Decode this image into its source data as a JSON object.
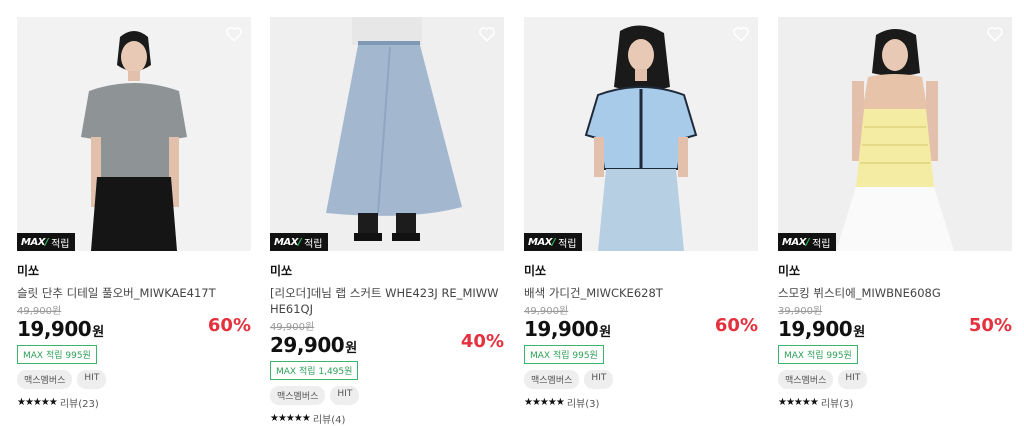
{
  "products": [
    {
      "badge": "적립",
      "brand": "미쏘",
      "name": "슬릿 단추 디테일 풀오버_MIWKAE417T",
      "original_price": "49,900원",
      "price": "19,900",
      "currency": "원",
      "discount": "60%",
      "reward": "MAX 적립 995원",
      "tags": [
        "맥스멤버스",
        "HIT"
      ],
      "stars": "★★★★★",
      "review": "리뷰(23)"
    },
    {
      "badge": "적립",
      "brand": "미쏘",
      "name": "[리오더]데님 랩 스커트 WHE423J RE_MIWWHE61QJ",
      "original_price": "49,900원",
      "price": "29,900",
      "currency": "원",
      "discount": "40%",
      "reward": "MAX 적립 1,495원",
      "tags": [
        "맥스멤버스",
        "HIT"
      ],
      "stars": "★★★★★",
      "review": "리뷰(4)"
    },
    {
      "badge": "적립",
      "brand": "미쏘",
      "name": "배색 가디건_MIWCKE628T",
      "original_price": "49,900원",
      "price": "19,900",
      "currency": "원",
      "discount": "60%",
      "reward": "MAX 적립 995원",
      "tags": [
        "맥스멤버스",
        "HIT"
      ],
      "stars": "★★★★★",
      "review": "리뷰(3)"
    },
    {
      "badge": "적립",
      "brand": "미쏘",
      "name": "스모킹 뷔스티에_MIWBNE608G",
      "original_price": "39,900원",
      "price": "19,900",
      "currency": "원",
      "discount": "50%",
      "reward": "MAX 적립 995원",
      "tags": [
        "맥스멤버스",
        "HIT"
      ],
      "stars": "★★★★★",
      "review": "리뷰(3)"
    }
  ],
  "colors": {
    "discount": "#e5303d",
    "reward_border": "#3bb56b",
    "badge_bg": "#111111"
  }
}
